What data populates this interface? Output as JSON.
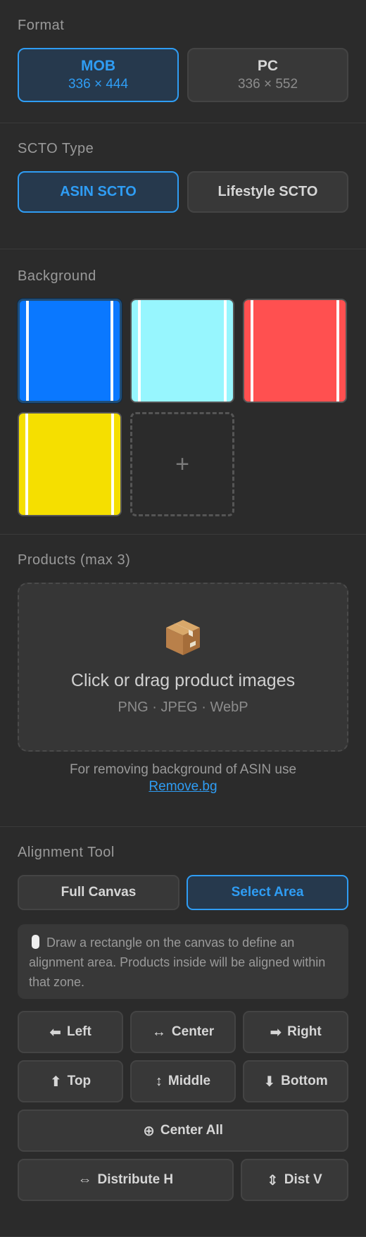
{
  "format": {
    "title": "Format",
    "options": [
      {
        "label": "MOB",
        "size": "336 × 444",
        "active": true
      },
      {
        "label": "PC",
        "size": "336 × 552",
        "active": false
      }
    ]
  },
  "scto": {
    "title": "SCTO Type",
    "options": [
      {
        "label": "ASIN SCTO",
        "active": true
      },
      {
        "label": "Lifestyle SCTO",
        "active": false
      }
    ]
  },
  "background": {
    "title": "Background",
    "swatches": [
      {
        "color": "#0a78ff",
        "selected": true
      },
      {
        "color": "#97f6fe",
        "selected": false
      },
      {
        "color": "#ff5050",
        "selected": false
      },
      {
        "color": "#f5df00",
        "selected": false
      }
    ],
    "add_label": "+"
  },
  "products": {
    "title": "Products (max 3)",
    "drop_icon": "package-icon",
    "drop_text": "Click or drag product images",
    "drop_formats": "PNG · JPEG · WebP",
    "note_text": "For removing background of ASIN use",
    "note_link": "Remove.bg"
  },
  "alignment": {
    "title": "Alignment Tool",
    "modes": [
      {
        "label": "Full Canvas",
        "active": false
      },
      {
        "label": "Select Area",
        "active": true
      }
    ],
    "hint_icon": "mouse-icon",
    "hint": "Draw a rectangle on the canvas to define an alignment area. Products inside will be aligned within that zone.",
    "buttons": {
      "left": {
        "icon": "⬅",
        "label": "Left"
      },
      "center": {
        "icon": "↔",
        "label": "Center"
      },
      "right": {
        "icon": "➡",
        "label": "Right"
      },
      "top": {
        "icon": "⬆",
        "label": "Top"
      },
      "middle": {
        "icon": "↕",
        "label": "Middle"
      },
      "bottom": {
        "icon": "⬇",
        "label": "Bottom"
      },
      "center_all": {
        "icon": "⊕",
        "label": "Center All"
      },
      "distribute_h": {
        "icon": "⇔",
        "label": "Distribute H"
      },
      "dist_v": {
        "icon": "⇕",
        "label": "Dist V"
      }
    }
  }
}
